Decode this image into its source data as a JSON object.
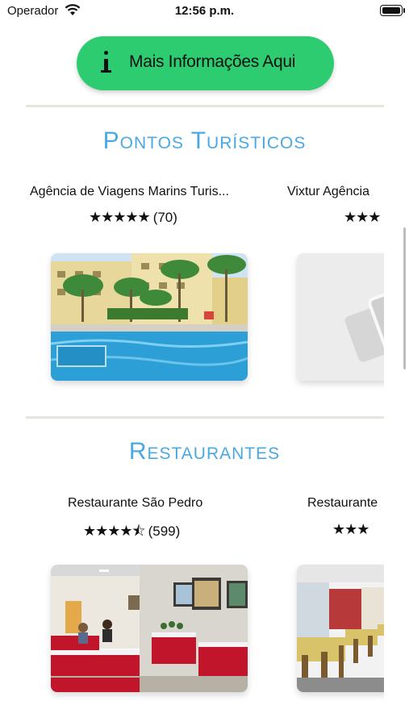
{
  "status_bar": {
    "carrier": "Operador",
    "time": "12:56 p.m."
  },
  "info_button": {
    "label": "Mais Informações Aqui",
    "icon": "info-icon"
  },
  "sections": [
    {
      "title": "Pontos Turísticos",
      "cards": [
        {
          "name": "Agência de Viagens Marins Turis...",
          "stars": "★★★★★",
          "count": "(70)",
          "image": "hotel-pool-photo"
        },
        {
          "name": "Vixtur Agência",
          "stars": "★★★",
          "count": "",
          "image": "placeholder-photo"
        }
      ]
    },
    {
      "title": "Restaurantes",
      "cards": [
        {
          "name": "Restaurante São Pedro",
          "stars": "★★★★⯪",
          "count": "(599)",
          "image": "restaurant-dining-room-photo"
        },
        {
          "name": "Restaurante",
          "stars": "★★★",
          "count": "",
          "image": "restaurant-interior-photo"
        }
      ]
    }
  ],
  "colors": {
    "accent_green": "#2ecc71",
    "title_blue": "#4aa9e2",
    "divider": "#e8e5df"
  }
}
